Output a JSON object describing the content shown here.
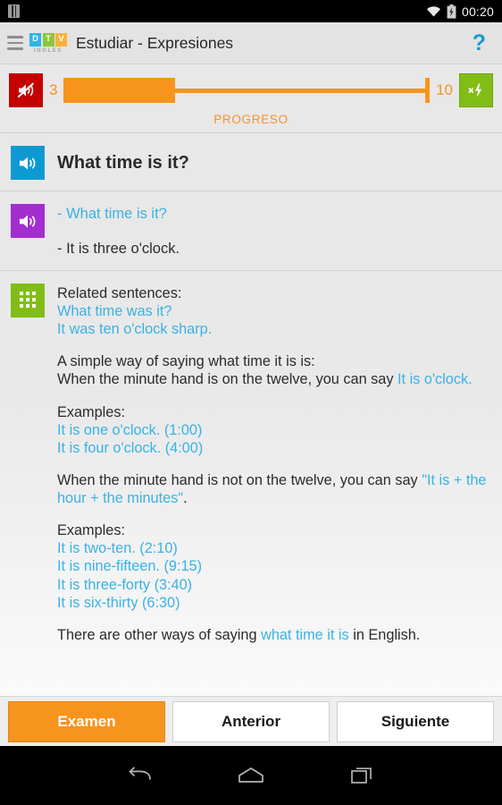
{
  "statusbar": {
    "sim_icon": "sim-card-icon",
    "wifi_icon": "wifi-icon",
    "battery_icon": "battery-charging-icon",
    "clock": "00:20"
  },
  "header": {
    "menu_icon": "hamburger-menu-icon",
    "logo": {
      "letters": [
        "D",
        "T",
        "V"
      ],
      "colors": [
        "#29b6e8",
        "#8cc63f",
        "#fbb03b"
      ],
      "subtitle": "INGLES"
    },
    "title": "Estudiar - Expresiones",
    "help_label": "?",
    "help_color": "#1a9bc9"
  },
  "progress": {
    "mute_icon": "speaker-muted-icon",
    "mute_color": "#c50000",
    "current": "3",
    "total": "10",
    "percent": 30.5,
    "label": "PROGRESO",
    "accent_color": "#f7941e",
    "boost_icon": "multiply-lightning-icon",
    "boost_color": "#82bd16"
  },
  "question": {
    "audio_icon": "speaker-icon",
    "audio_color": "#0d9ad2",
    "text": "What time is it?"
  },
  "dialogue": {
    "audio_icon": "speaker-icon",
    "audio_color": "#a22ed0",
    "line_question": "- What time is it?",
    "line_answer": "- It is three o'clock."
  },
  "related": {
    "grid_icon": "keypad-grid-icon",
    "grid_color": "#82bd16",
    "heading": "Related sentences:",
    "sentences": [
      "What time was it?",
      "It was ten o'clock sharp."
    ],
    "explain_1_line1": "A simple way of saying what time it is is:",
    "explain_1_line2_black": "When the minute hand is on the twelve, you can say ",
    "explain_1_line2_blue": "It is o'clock.",
    "examples_1_heading": "Examples:",
    "examples_1": [
      "It is one o'clock. (1:00)",
      "It is four o'clock. (4:00)"
    ],
    "explain_2_black": "When the minute hand is not on the twelve, you can say ",
    "explain_2_blue": "\"It is + the hour + the minutes\"",
    "explain_2_tail": ".",
    "examples_2_heading": "Examples:",
    "examples_2": [
      "It is two-ten. (2:10)",
      "It is nine-fifteen. (9:15)",
      "It is three-forty (3:40)",
      "It is six-thirty (6:30)"
    ],
    "closing_black_1": "There are other ways of saying ",
    "closing_blue": "what time it is",
    "closing_black_2": " in English."
  },
  "bottom": {
    "exam_label": "Examen",
    "prev_label": "Anterior",
    "next_label": "Siguiente"
  },
  "navbar": {
    "back_icon": "back-icon",
    "home_icon": "home-icon",
    "recents_icon": "recent-apps-icon"
  }
}
